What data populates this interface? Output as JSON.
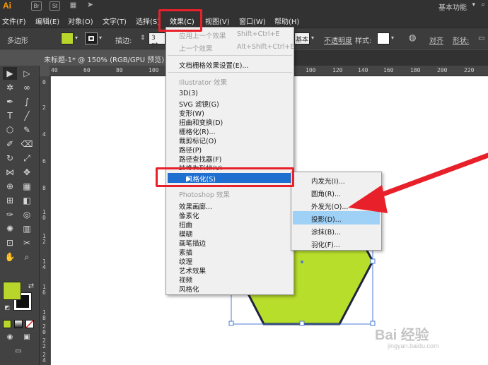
{
  "app": {
    "logo": "Ai",
    "bridge_icon": "Br",
    "stock_icon": "St",
    "workspace_label": "基本功能"
  },
  "menubar": {
    "items": [
      "文件(F)",
      "编辑(E)",
      "对象(O)",
      "文字(T)",
      "选择(S)",
      "效果(C)",
      "视图(V)",
      "窗口(W)",
      "帮助(H)"
    ]
  },
  "control_bar": {
    "object_type": "多边形",
    "fill_color": "#b8d52c",
    "stroke_label": "描边:",
    "stroke_value": "3 pt",
    "basic_label": "基本",
    "opacity_label": "不透明度",
    "style_label": "样式:",
    "align_label": "对齐",
    "shape_label": "形状:"
  },
  "document_tab": {
    "title": "未标题-1* @ 150% (RGB/GPU 预览)"
  },
  "rulers": {
    "top_left_ticks": [
      "40",
      "60",
      "80",
      "100"
    ],
    "top_right_ticks": [
      "100",
      "120",
      "140",
      "160",
      "180",
      "200",
      "220"
    ],
    "left_ticks": [
      "0",
      "2",
      "4",
      "6",
      "8",
      "1",
      "0",
      "1",
      "2",
      "1",
      "4",
      "1",
      "6",
      "1",
      "8",
      "2",
      "0",
      "2",
      "2",
      "2",
      "4"
    ]
  },
  "effect_menu": {
    "apply_last": {
      "label": "应用上一个效果",
      "shortcut": "Shift+Ctrl+E"
    },
    "last_effect": {
      "label": "上一个效果",
      "shortcut": "Alt+Shift+Ctrl+E"
    },
    "document_raster": "文档栅格效果设置(E)...",
    "illustrator_header": "Illustrator 效果",
    "illustrator_items": [
      "3D(3)",
      "SVG 滤镜(G)",
      "变形(W)",
      "扭曲和变换(D)",
      "栅格化(R)...",
      "裁剪标记(O)",
      "路径(P)",
      "路径查找器(F)",
      "转换为形状(V)"
    ],
    "stylize": "风格化(S)",
    "photoshop_header": "Photoshop 效果",
    "photoshop_items": [
      "效果画廊...",
      "像素化",
      "扭曲",
      "模糊",
      "画笔描边",
      "素描",
      "纹理",
      "艺术效果",
      "视频",
      "风格化"
    ]
  },
  "stylize_submenu": {
    "items": [
      "内发光(I)...",
      "圆角(R)...",
      "外发光(O)...",
      "投影(D)...",
      "涂抹(B)...",
      "羽化(F)..."
    ],
    "highlighted": "投影(D)..."
  },
  "canvas": {
    "shape_fill": "#b8de2c",
    "shape_stroke": "#1f2440"
  },
  "toolbar": {
    "fill_color": "#b8d52c"
  },
  "annotation_color": "#e8202a",
  "highlight_color": "#1e6fd0",
  "watermark": {
    "brand": "Bai 经验",
    "url": "jingyan.baidu.com"
  }
}
